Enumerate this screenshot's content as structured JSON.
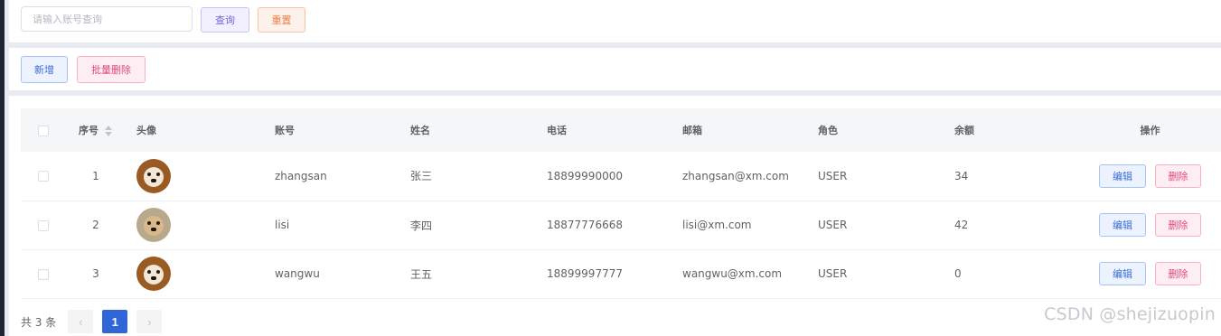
{
  "search": {
    "placeholder": "请输入账号查询",
    "value": ""
  },
  "buttons": {
    "query": "查询",
    "reset": "重置",
    "add": "新增",
    "batch_delete": "批量删除"
  },
  "table": {
    "columns": [
      "序号",
      "头像",
      "账号",
      "姓名",
      "电话",
      "邮箱",
      "角色",
      "余额",
      "操作"
    ],
    "rows": [
      {
        "index": "1",
        "account": "zhangsan",
        "name": "张三",
        "phone": "18899990000",
        "email": "zhangsan@xm.com",
        "role": "USER",
        "balance": "34",
        "avatar": "shiba-avatar"
      },
      {
        "index": "2",
        "account": "lisi",
        "name": "李四",
        "phone": "18877776668",
        "email": "lisi@xm.com",
        "role": "USER",
        "balance": "42",
        "avatar": "labrador-avatar"
      },
      {
        "index": "3",
        "account": "wangwu",
        "name": "王五",
        "phone": "18899997777",
        "email": "wangwu@xm.com",
        "role": "USER",
        "balance": "0",
        "avatar": "shiba-avatar"
      }
    ],
    "row_actions": {
      "edit": "编辑",
      "delete": "删除"
    }
  },
  "pagination": {
    "total_text": "共 3 条",
    "current_page": "1",
    "prev_icon": "‹",
    "next_icon": "›"
  },
  "watermark": "CSDN @shejizuopin",
  "colors": {
    "primary": "#2f67d8",
    "query": "#6f67d9",
    "reset": "#ee7f42",
    "danger": "#e2497a"
  }
}
